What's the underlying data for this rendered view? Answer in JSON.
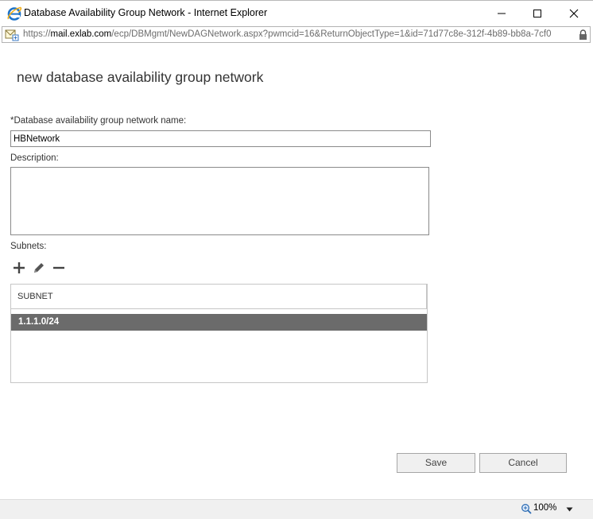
{
  "window": {
    "title": "Database Availability Group Network - Internet Explorer",
    "url_scheme": "https://",
    "url_host": "mail.exlab.com",
    "url_path": "/ecp/DBMgmt/NewDAGNetwork.aspx?pwmcid=16&ReturnObjectType=1&id=71d77c8e-312f-4b89-bb8a-7cf0"
  },
  "form": {
    "title": "new database availability group network",
    "name_label": "*Database availability group network name:",
    "name_value": "HBNetwork",
    "description_label": "Description:",
    "description_value": "",
    "subnets_label": "Subnets:",
    "subnet_column_header": "SUBNET",
    "subnets": [
      "1.1.1.0/24"
    ]
  },
  "buttons": {
    "save": "Save",
    "cancel": "Cancel"
  },
  "status": {
    "zoom": "100%"
  },
  "colors": {
    "selected_row": "#6b6b6b",
    "ie_blue": "#1e73c8"
  },
  "icons": [
    "internet-explorer-icon",
    "minimize-icon",
    "maximize-icon",
    "close-icon",
    "page-icon",
    "lock-icon",
    "add-icon",
    "edit-icon",
    "remove-icon",
    "zoom-icon",
    "chevron-down-icon"
  ]
}
